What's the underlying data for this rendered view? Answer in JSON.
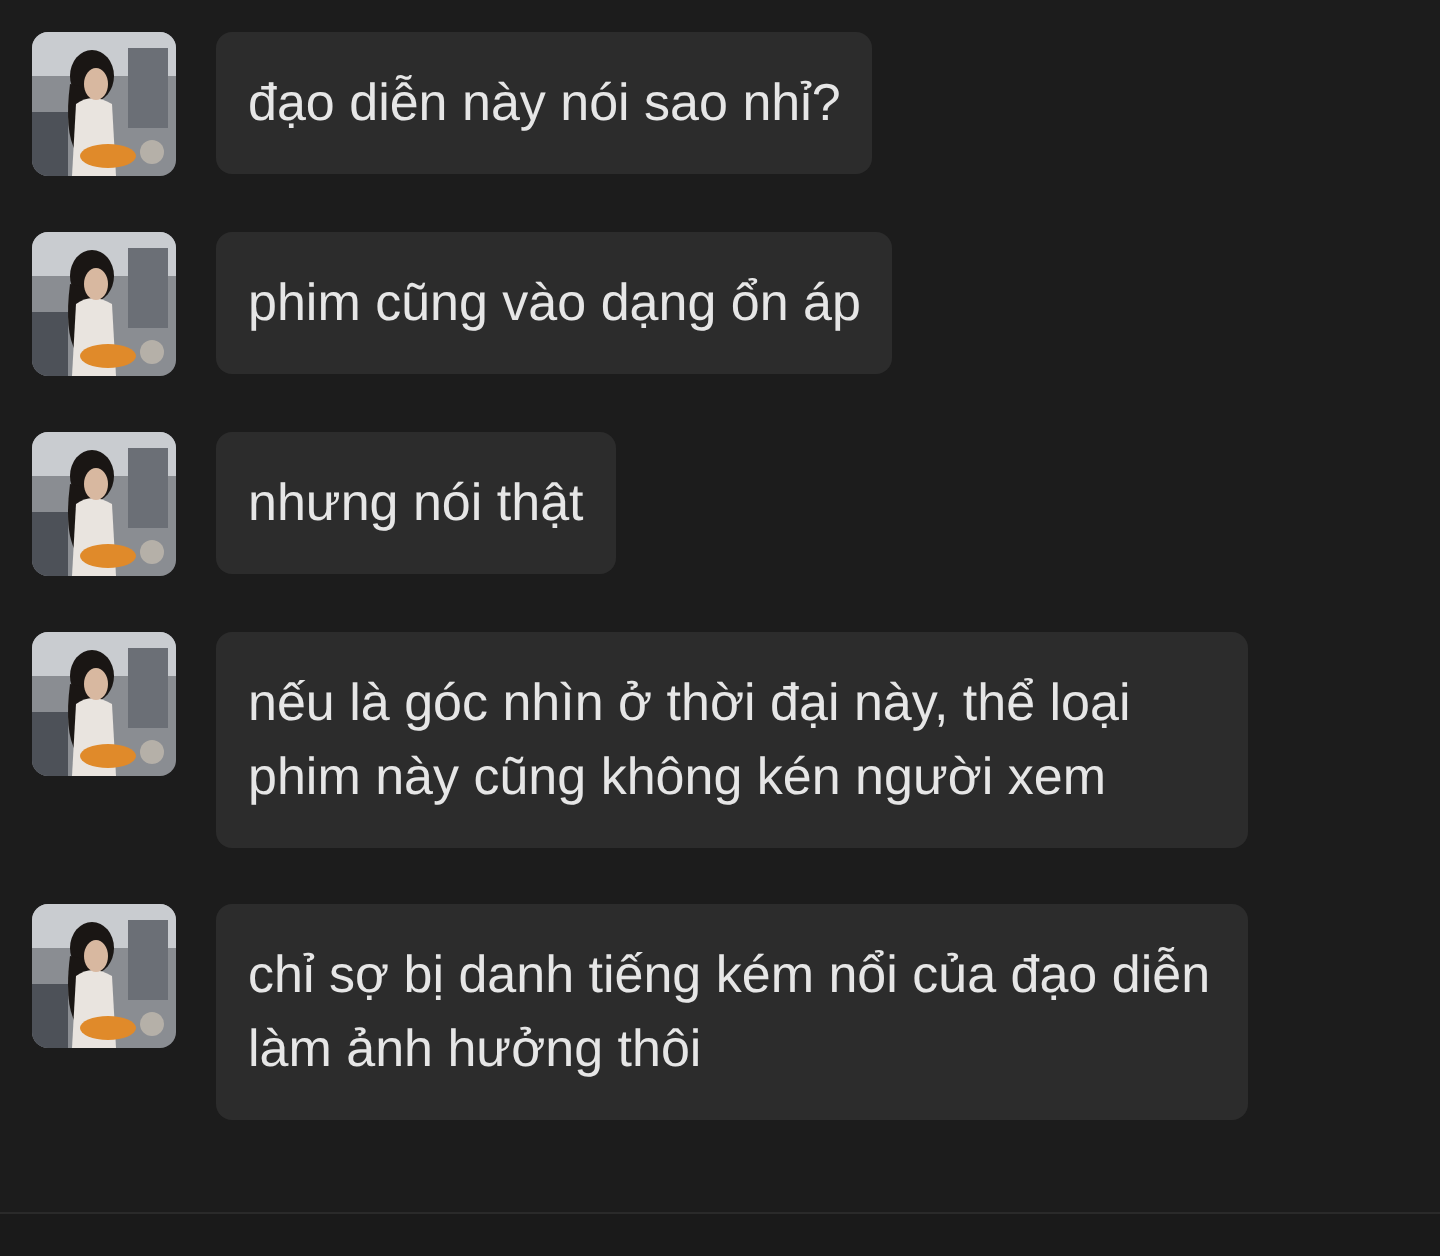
{
  "messages": [
    {
      "text": "đạo diễn này nói sao nhỉ?"
    },
    {
      "text": "phim cũng vào dạng ổn áp"
    },
    {
      "text": "nhưng nói thật"
    },
    {
      "text": "nếu là góc nhìn ở thời đại này, thể loại phim này cũng không kén người xem"
    },
    {
      "text": "chỉ sợ bị danh tiếng kém nổi của đạo diễn làm ảnh hưởng thôi"
    }
  ]
}
